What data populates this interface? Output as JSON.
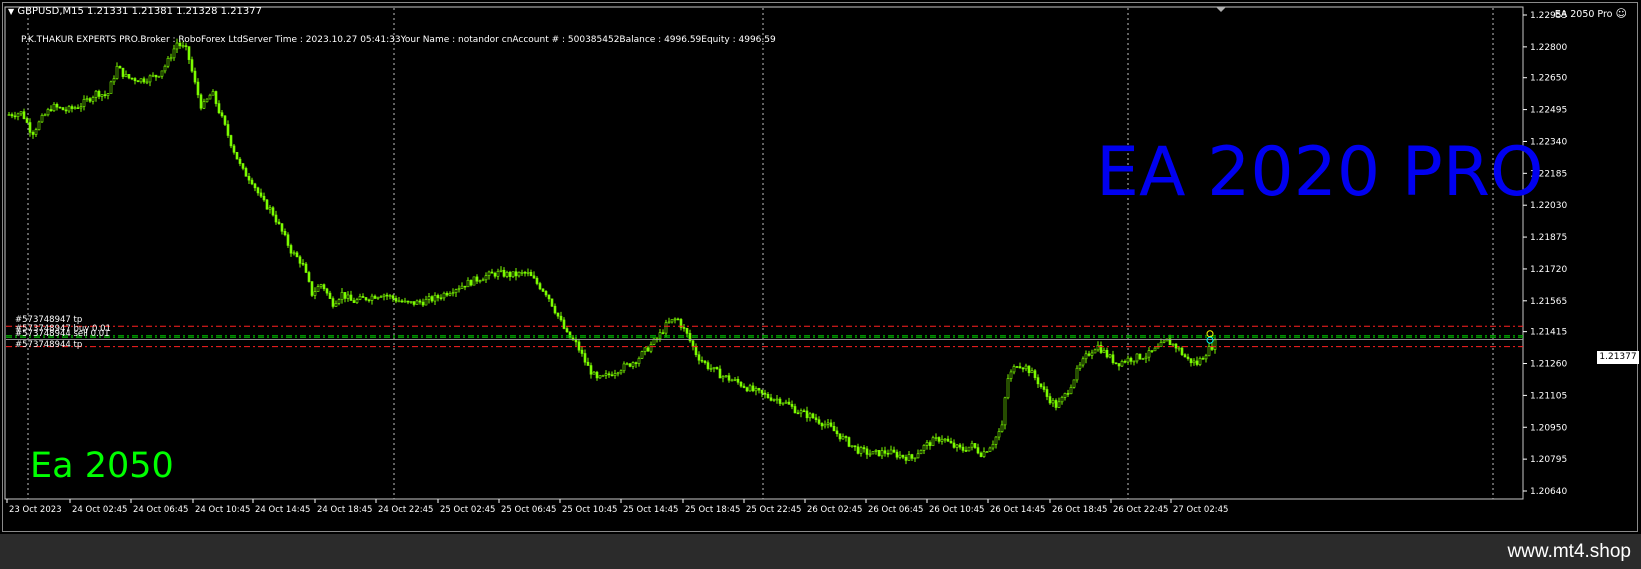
{
  "header": {
    "symbol_line": "GBPUSD,M15  1.21331 1.21381 1.21328 1.21377",
    "info_line": "P.K.THAKUR EXPERTS PRO.Broker   : RoboForex LtdServer Time : 2023.10.27 05:41:33Your Name    : notandor cnAccount  #  : 500385452Balance : 4996.59Equity    : 4996.59",
    "ea_label": "EA 2050 Pro"
  },
  "overlay": {
    "ea_title": "EA 2020 PRO",
    "ea_green": "Ea 2050"
  },
  "orders": [
    {
      "label": "#573748947 tp",
      "price": 1.21441,
      "color": "#ff2020"
    },
    {
      "label": "#573748947 buy 0.01",
      "price": 1.21395,
      "color": "#00c000"
    },
    {
      "label": "#573748944 sell 0.01",
      "price": 1.21388,
      "color": "#00c000"
    },
    {
      "label": "#573748944 tp",
      "price": 1.21342,
      "color": "#ff2020"
    }
  ],
  "current_price": "1.21377",
  "price_axis": [
    "1.22955",
    "1.22800",
    "1.22650",
    "1.22495",
    "1.22340",
    "1.22185",
    "1.22030",
    "1.21875",
    "1.21720",
    "1.21565",
    "1.21415",
    "1.21260",
    "1.21105",
    "1.20950",
    "1.20795",
    "1.20640"
  ],
  "time_axis": [
    "23 Oct 2023",
    "24 Oct 02:45",
    "24 Oct 06:45",
    "24 Oct 10:45",
    "24 Oct 14:45",
    "24 Oct 18:45",
    "24 Oct 22:45",
    "25 Oct 02:45",
    "25 Oct 06:45",
    "25 Oct 10:45",
    "25 Oct 14:45",
    "25 Oct 18:45",
    "25 Oct 22:45",
    "26 Oct 02:45",
    "26 Oct 06:45",
    "26 Oct 10:45",
    "26 Oct 14:45",
    "26 Oct 18:45",
    "26 Oct 22:45",
    "27 Oct 02:45"
  ],
  "price_key": [
    [
      0,
      1.2247
    ],
    [
      15,
      1.2248
    ],
    [
      25,
      1.2238
    ],
    [
      35,
      1.2245
    ],
    [
      45,
      1.2251
    ],
    [
      60,
      1.2249
    ],
    [
      75,
      1.2252
    ],
    [
      90,
      1.2258
    ],
    [
      100,
      1.2256
    ],
    [
      110,
      1.227
    ],
    [
      120,
      1.2265
    ],
    [
      135,
      1.2264
    ],
    [
      150,
      1.2266
    ],
    [
      160,
      1.2272
    ],
    [
      170,
      1.2282
    ],
    [
      180,
      1.2278
    ],
    [
      188,
      1.2262
    ],
    [
      195,
      1.225
    ],
    [
      205,
      1.2258
    ],
    [
      215,
      1.2245
    ],
    [
      225,
      1.2232
    ],
    [
      235,
      1.222
    ],
    [
      245,
      1.2215
    ],
    [
      255,
      1.2205
    ],
    [
      265,
      1.22
    ],
    [
      275,
      1.219
    ],
    [
      285,
      1.218
    ],
    [
      295,
      1.2175
    ],
    [
      305,
      1.216
    ],
    [
      315,
      1.2165
    ],
    [
      325,
      1.2155
    ],
    [
      335,
      1.216
    ],
    [
      345,
      1.2156
    ],
    [
      360,
      1.2158
    ],
    [
      375,
      1.216
    ],
    [
      390,
      1.2157
    ],
    [
      400,
      1.2155
    ],
    [
      415,
      1.2156
    ],
    [
      430,
      1.2158
    ],
    [
      445,
      1.2162
    ],
    [
      460,
      1.2165
    ],
    [
      475,
      1.2168
    ],
    [
      490,
      1.217
    ],
    [
      505,
      1.2169
    ],
    [
      520,
      1.217
    ],
    [
      530,
      1.2165
    ],
    [
      540,
      1.216
    ],
    [
      550,
      1.215
    ],
    [
      560,
      1.214
    ],
    [
      570,
      1.2135
    ],
    [
      580,
      1.2125
    ],
    [
      590,
      1.2118
    ],
    [
      600,
      1.212
    ],
    [
      610,
      1.2123
    ],
    [
      620,
      1.2125
    ],
    [
      630,
      1.2128
    ],
    [
      640,
      1.2133
    ],
    [
      650,
      1.2138
    ],
    [
      660,
      1.2145
    ],
    [
      670,
      1.2148
    ],
    [
      680,
      1.214
    ],
    [
      690,
      1.213
    ],
    [
      700,
      1.2125
    ],
    [
      715,
      1.212
    ],
    [
      730,
      1.2117
    ],
    [
      745,
      1.2113
    ],
    [
      760,
      1.211
    ],
    [
      775,
      1.2108
    ],
    [
      790,
      1.2103
    ],
    [
      805,
      1.21
    ],
    [
      820,
      1.2096
    ],
    [
      835,
      1.209
    ],
    [
      850,
      1.2084
    ],
    [
      865,
      1.2082
    ],
    [
      880,
      1.2083
    ],
    [
      895,
      1.2081
    ],
    [
      905,
      1.208
    ],
    [
      915,
      1.2085
    ],
    [
      925,
      1.2088
    ],
    [
      935,
      1.209
    ],
    [
      945,
      1.2086
    ],
    [
      955,
      1.2084
    ],
    [
      965,
      1.2086
    ],
    [
      975,
      1.2082
    ],
    [
      985,
      1.2087
    ],
    [
      995,
      1.2095
    ],
    [
      1000,
      1.2118
    ],
    [
      1010,
      1.2126
    ],
    [
      1020,
      1.2124
    ],
    [
      1030,
      1.2118
    ],
    [
      1040,
      1.211
    ],
    [
      1050,
      1.2105
    ],
    [
      1060,
      1.2112
    ],
    [
      1070,
      1.2122
    ],
    [
      1080,
      1.213
    ],
    [
      1090,
      1.2135
    ],
    [
      1100,
      1.213
    ],
    [
      1110,
      1.2126
    ],
    [
      1120,
      1.2128
    ],
    [
      1130,
      1.2129
    ],
    [
      1140,
      1.213
    ],
    [
      1150,
      1.2133
    ],
    [
      1160,
      1.2137
    ],
    [
      1170,
      1.2134
    ],
    [
      1180,
      1.2128
    ],
    [
      1190,
      1.2126
    ],
    [
      1200,
      1.2132
    ],
    [
      1210,
      1.2137
    ]
  ],
  "colors": {
    "background": "#000000",
    "candles": "#7cfc00",
    "grid": "#c0c0c0",
    "axis_text": "#ffffff",
    "tp_line": "#ff2020",
    "order_line": "#00c000",
    "ask_line": "#a0a0a0"
  }
}
